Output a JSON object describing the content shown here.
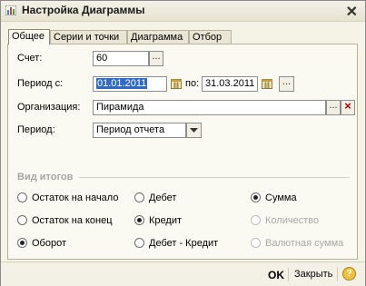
{
  "window": {
    "title": "Настройка Диаграммы",
    "close_label": "✕"
  },
  "tabs": [
    {
      "label": "Общее",
      "active": true
    },
    {
      "label": "Серии и точки",
      "active": false
    },
    {
      "label": "Диаграмма",
      "active": false
    },
    {
      "label": "Отбор",
      "active": false
    }
  ],
  "form": {
    "account": {
      "label": "Счет:",
      "value": "60",
      "button": "..."
    },
    "period_from": {
      "label": "Период с:",
      "value": "01.01.2011",
      "to_label": "по:",
      "to_value": "31.03.2011",
      "button": "..."
    },
    "organization": {
      "label": "Организация:",
      "value": "Пирамида",
      "button": "...",
      "clear": "×"
    },
    "period": {
      "label": "Период:",
      "value": "Период отчета"
    }
  },
  "totals": {
    "title": "Вид итогов",
    "col1": [
      {
        "label": "Остаток на начало",
        "checked": false,
        "disabled": false
      },
      {
        "label": "Остаток на конец",
        "checked": false,
        "disabled": false
      },
      {
        "label": "Оборот",
        "checked": true,
        "disabled": false
      }
    ],
    "col2": [
      {
        "label": "Дебет",
        "checked": false,
        "disabled": false
      },
      {
        "label": "Кредит",
        "checked": true,
        "disabled": false
      },
      {
        "label": "Дебет - Кредит",
        "checked": false,
        "disabled": false
      }
    ],
    "col3": [
      {
        "label": "Сумма",
        "checked": true,
        "disabled": false
      },
      {
        "label": "Количество",
        "checked": false,
        "disabled": true
      },
      {
        "label": "Валютная сумма",
        "checked": false,
        "disabled": true
      }
    ]
  },
  "footer": {
    "ok": "OK",
    "close": "Закрыть",
    "help": "?"
  },
  "colors": {
    "selection": "#316ac5",
    "window_bg": "#f5f3e6",
    "panel_bg": "#fbfaf2"
  }
}
